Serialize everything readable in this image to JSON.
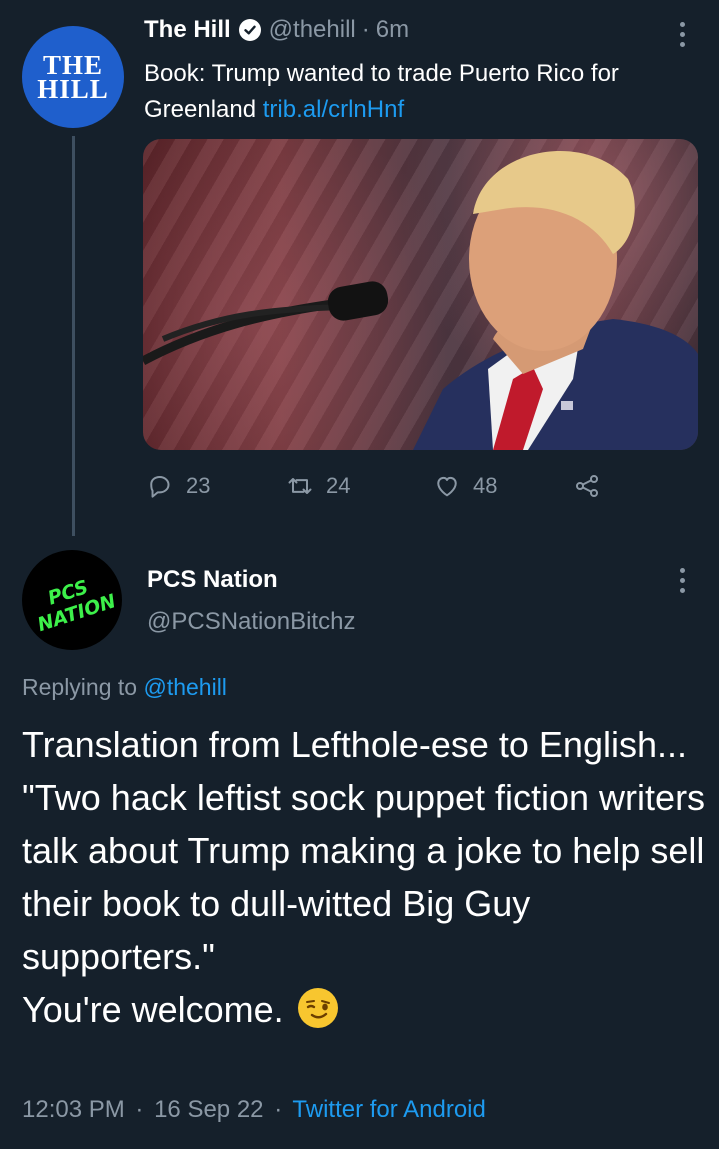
{
  "parent": {
    "avatar_lines": [
      "THE",
      "HILL"
    ],
    "name": "The Hill",
    "handle": "@thehill",
    "separator": "·",
    "time": "6m",
    "text": "Book: Trump wanted to trade Puerto Rico for Greenland",
    "link": "trib.al/crlnHnf",
    "stats": {
      "replies": "23",
      "retweets": "24",
      "likes": "48"
    }
  },
  "reply": {
    "avatar_text": [
      "PCS",
      "NATION"
    ],
    "name": "PCS Nation",
    "handle": "@PCSNationBitchz",
    "replying_prefix": "Replying to",
    "replying_handle": "@thehill",
    "lines": [
      "Translation from Lefthole-ese to English...",
      "\"Two hack leftist sock puppet fiction writers talk about Trump making a joke to help sell their book to dull-witted Big Guy supporters.\"",
      "You're welcome."
    ],
    "emoji": "winking-face",
    "time": "12:03 PM",
    "date": "16 Sep 22",
    "dot": "·",
    "source": "Twitter for Android"
  },
  "colors": {
    "background": "#15202b",
    "accent": "#1d9bf0",
    "muted": "#8b98a5"
  }
}
